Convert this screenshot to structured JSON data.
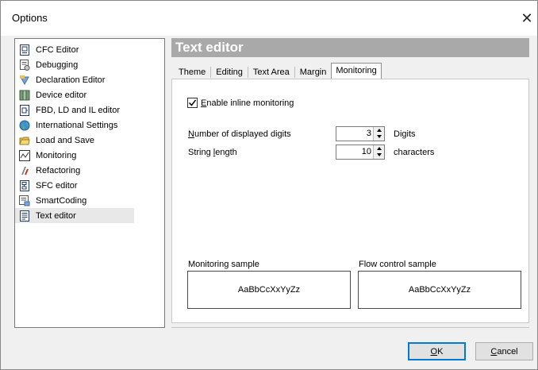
{
  "window": {
    "title": "Options",
    "close_glyph": "✕"
  },
  "tree": {
    "items": [
      {
        "label": "CFC Editor",
        "icon": "cfc-editor-icon"
      },
      {
        "label": "Debugging",
        "icon": "debugging-icon"
      },
      {
        "label": "Declaration Editor",
        "icon": "declaration-editor-icon"
      },
      {
        "label": "Device editor",
        "icon": "device-editor-icon"
      },
      {
        "label": "FBD, LD and IL editor",
        "icon": "fbd-ld-il-editor-icon"
      },
      {
        "label": "International Settings",
        "icon": "globe-icon"
      },
      {
        "label": "Load and Save",
        "icon": "folder-icon"
      },
      {
        "label": "Monitoring",
        "icon": "monitoring-icon"
      },
      {
        "label": "Refactoring",
        "icon": "refactoring-icon"
      },
      {
        "label": "SFC editor",
        "icon": "sfc-editor-icon"
      },
      {
        "label": "SmartCoding",
        "icon": "smartcoding-icon"
      },
      {
        "label": "Text editor",
        "icon": "text-editor-icon",
        "selected": true
      }
    ]
  },
  "header": {
    "title": "Text editor",
    "bg_color": "#a9a9a9"
  },
  "tabs": [
    {
      "label": "Theme"
    },
    {
      "label": "Editing"
    },
    {
      "label": "Text Area"
    },
    {
      "label": "Margin"
    },
    {
      "label": "Monitoring",
      "active": true
    }
  ],
  "monitoring": {
    "enable_inline": {
      "label_prefix": "E",
      "label_rest": "nable inline monitoring",
      "checked": true
    },
    "digits": {
      "label_prefix": "N",
      "label_rest": "umber of displayed digits",
      "value": "3",
      "unit": "Digits"
    },
    "string_length": {
      "label_prefix": "String ",
      "label_ul": "l",
      "label_rest": "ength",
      "value": "10",
      "unit": "characters"
    },
    "monitoring_sample": {
      "label": "Monitoring sample",
      "text": "AaBbCcXxYyZz"
    },
    "flow_control_sample": {
      "label": "Flow control sample",
      "text": "AaBbCcXxYyZz"
    }
  },
  "buttons": {
    "ok": {
      "ul": "O",
      "rest": "K"
    },
    "cancel": {
      "ul": "C",
      "rest": "ancel"
    }
  },
  "colors": {
    "accent": "#0078d7"
  }
}
